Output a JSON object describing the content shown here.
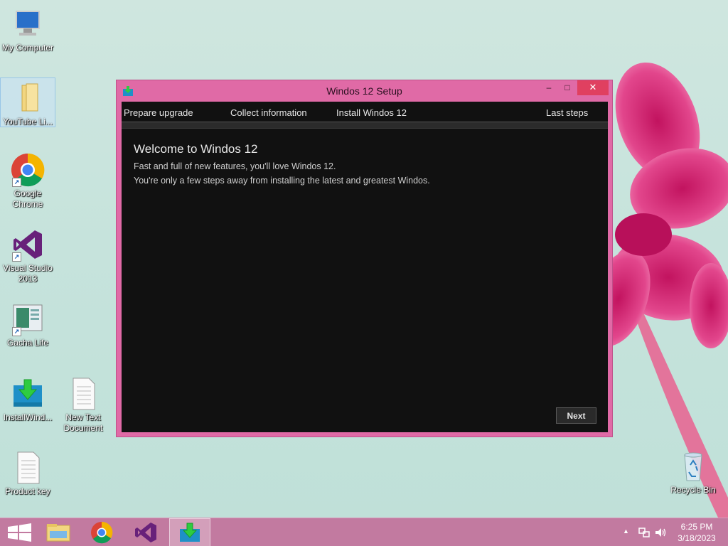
{
  "desktop": {
    "icons": [
      {
        "label": "My Computer"
      },
      {
        "label": "YouTube Li..."
      },
      {
        "label": "Google Chrome"
      },
      {
        "label": "Visual Studio 2013"
      },
      {
        "label": "Gacha Life"
      },
      {
        "label": "InstallWind..."
      },
      {
        "label": "New Text Document"
      },
      {
        "label": "Product key"
      },
      {
        "label": "Recycle Bin"
      }
    ]
  },
  "window": {
    "title": "Windos 12 Setup",
    "controls": {
      "minimize": "–",
      "maximize": "□",
      "close": "✕"
    },
    "steps": [
      "Prepare upgrade",
      "Collect information",
      "Install Windos 12",
      "Last steps"
    ],
    "heading": "Welcome to Windos 12",
    "lines": [
      "Fast and full of new features, you'll love Windos 12.",
      "You're only a few steps away from installing the latest and greatest Windos."
    ],
    "next_label": "Next"
  },
  "taskbar": {
    "clock_time": "6:25 PM",
    "clock_date": "3/18/2023",
    "tray_chevron": "▲"
  },
  "colors": {
    "window_frame": "#e06aa6",
    "client_bg": "#111111",
    "taskbar": "#c27aa0",
    "close_button": "#e04060"
  }
}
